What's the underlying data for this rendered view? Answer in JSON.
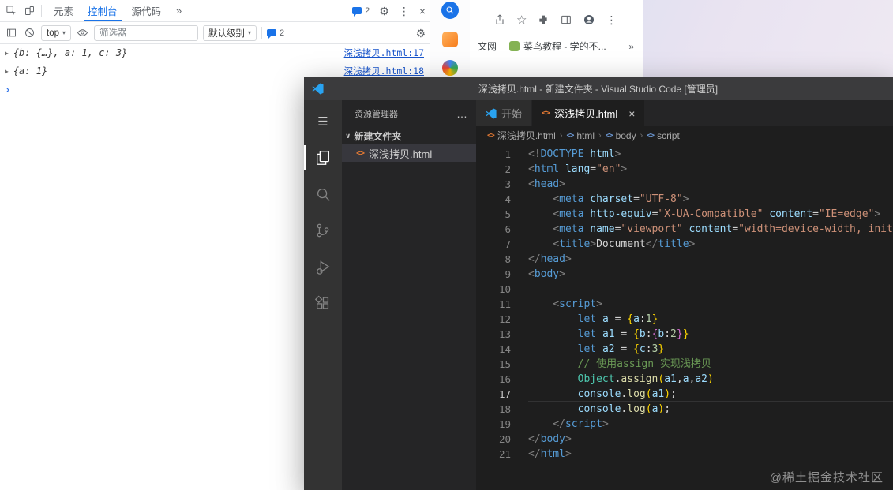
{
  "devtools": {
    "tabs": [
      {
        "label": "元素",
        "active": false
      },
      {
        "label": "控制台",
        "active": true
      },
      {
        "label": "源代码",
        "active": false
      }
    ],
    "tabs_overflow": "»",
    "header_issues_count": "2",
    "toolbar": {
      "context_value": "top",
      "filter_placeholder": "筛选器",
      "levels_value": "默认级别",
      "issues_count": "2"
    },
    "messages": [
      {
        "preview": "{b: {…}, a: 1, c: 3}",
        "source_link": "深浅拷贝.html:17"
      },
      {
        "preview": "{a: 1}",
        "source_link": "深浅拷贝.html:18"
      }
    ],
    "prompt_glyph": "›"
  },
  "browser": {
    "bookmarks": [
      {
        "label": "文网",
        "favicon": false
      },
      {
        "label": "菜鸟教程 - 学的不...",
        "favicon": true
      }
    ],
    "bookmarks_overflow": "»"
  },
  "vscode": {
    "title": "深浅拷贝.html - 新建文件夹 - Visual Studio Code [管理员]",
    "explorer": {
      "header": "资源管理器",
      "actions": "…",
      "folder": "新建文件夹",
      "file": "深浅拷贝.html"
    },
    "tabs": [
      {
        "label": "开始",
        "icon": "vscode",
        "active": false,
        "closable": false
      },
      {
        "label": "深浅拷贝.html",
        "icon": "html",
        "active": true,
        "closable": true
      }
    ],
    "breadcrumbs": [
      "深浅拷贝.html",
      "html",
      "body",
      "script"
    ],
    "code": {
      "active_line": 17,
      "lines": [
        [
          [
            "pun",
            "<!"
          ],
          [
            "tag",
            "DOCTYPE"
          ],
          [
            "txt",
            " "
          ],
          [
            "attr",
            "html"
          ],
          [
            "pun",
            ">"
          ]
        ],
        [
          [
            "pun",
            "<"
          ],
          [
            "tag",
            "html"
          ],
          [
            "txt",
            " "
          ],
          [
            "attr",
            "lang"
          ],
          [
            "txt",
            "="
          ],
          [
            "str",
            "\"en\""
          ],
          [
            "pun",
            ">"
          ]
        ],
        [
          [
            "pun",
            "<"
          ],
          [
            "tag",
            "head"
          ],
          [
            "pun",
            ">"
          ]
        ],
        [
          [
            "txt",
            "    "
          ],
          [
            "pun",
            "<"
          ],
          [
            "tag",
            "meta"
          ],
          [
            "txt",
            " "
          ],
          [
            "attr",
            "charset"
          ],
          [
            "txt",
            "="
          ],
          [
            "str",
            "\"UTF-8\""
          ],
          [
            "pun",
            ">"
          ]
        ],
        [
          [
            "txt",
            "    "
          ],
          [
            "pun",
            "<"
          ],
          [
            "tag",
            "meta"
          ],
          [
            "txt",
            " "
          ],
          [
            "attr",
            "http-equiv"
          ],
          [
            "txt",
            "="
          ],
          [
            "str",
            "\"X-UA-Compatible\""
          ],
          [
            "txt",
            " "
          ],
          [
            "attr",
            "content"
          ],
          [
            "txt",
            "="
          ],
          [
            "str",
            "\"IE=edge\""
          ],
          [
            "pun",
            ">"
          ]
        ],
        [
          [
            "txt",
            "    "
          ],
          [
            "pun",
            "<"
          ],
          [
            "tag",
            "meta"
          ],
          [
            "txt",
            " "
          ],
          [
            "attr",
            "name"
          ],
          [
            "txt",
            "="
          ],
          [
            "str",
            "\"viewport\""
          ],
          [
            "txt",
            " "
          ],
          [
            "attr",
            "content"
          ],
          [
            "txt",
            "="
          ],
          [
            "str",
            "\"width=device-width, initi"
          ]
        ],
        [
          [
            "txt",
            "    "
          ],
          [
            "pun",
            "<"
          ],
          [
            "tag",
            "title"
          ],
          [
            "pun",
            ">"
          ],
          [
            "txt",
            "Document"
          ],
          [
            "pun",
            "</"
          ],
          [
            "tag",
            "title"
          ],
          [
            "pun",
            ">"
          ]
        ],
        [
          [
            "pun",
            "</"
          ],
          [
            "tag",
            "head"
          ],
          [
            "pun",
            ">"
          ]
        ],
        [
          [
            "pun",
            "<"
          ],
          [
            "tag",
            "body"
          ],
          [
            "pun",
            ">"
          ]
        ],
        [],
        [
          [
            "txt",
            "    "
          ],
          [
            "pun",
            "<"
          ],
          [
            "tag",
            "script"
          ],
          [
            "pun",
            ">"
          ]
        ],
        [
          [
            "txt",
            "        "
          ],
          [
            "kw",
            "let"
          ],
          [
            "txt",
            " "
          ],
          [
            "var",
            "a"
          ],
          [
            "txt",
            " = "
          ],
          [
            "b1",
            "{"
          ],
          [
            "var",
            "a"
          ],
          [
            "txt",
            ":"
          ],
          [
            "num",
            "1"
          ],
          [
            "b1",
            "}"
          ]
        ],
        [
          [
            "txt",
            "        "
          ],
          [
            "kw",
            "let"
          ],
          [
            "txt",
            " "
          ],
          [
            "var",
            "a1"
          ],
          [
            "txt",
            " = "
          ],
          [
            "b1",
            "{"
          ],
          [
            "var",
            "b"
          ],
          [
            "txt",
            ":"
          ],
          [
            "b2",
            "{"
          ],
          [
            "var",
            "b"
          ],
          [
            "txt",
            ":"
          ],
          [
            "num",
            "2"
          ],
          [
            "b2",
            "}"
          ],
          [
            "b1",
            "}"
          ]
        ],
        [
          [
            "txt",
            "        "
          ],
          [
            "kw",
            "let"
          ],
          [
            "txt",
            " "
          ],
          [
            "var",
            "a2"
          ],
          [
            "txt",
            " = "
          ],
          [
            "b1",
            "{"
          ],
          [
            "var",
            "c"
          ],
          [
            "txt",
            ":"
          ],
          [
            "num",
            "3"
          ],
          [
            "b1",
            "}"
          ]
        ],
        [
          [
            "txt",
            "        "
          ],
          [
            "com",
            "// 使用assign 实现浅拷贝"
          ]
        ],
        [
          [
            "txt",
            "        "
          ],
          [
            "cls",
            "Object"
          ],
          [
            "txt",
            "."
          ],
          [
            "fn",
            "assign"
          ],
          [
            "b1",
            "("
          ],
          [
            "var",
            "a1"
          ],
          [
            "txt",
            ","
          ],
          [
            "var",
            "a"
          ],
          [
            "txt",
            ","
          ],
          [
            "var",
            "a2"
          ],
          [
            "b1",
            ")"
          ]
        ],
        [
          [
            "txt",
            "        "
          ],
          [
            "var",
            "console"
          ],
          [
            "txt",
            "."
          ],
          [
            "fn",
            "log"
          ],
          [
            "b1",
            "("
          ],
          [
            "var",
            "a1"
          ],
          [
            "b1",
            ")"
          ],
          [
            "txt",
            ";"
          ],
          [
            "cursor",
            ""
          ]
        ],
        [
          [
            "txt",
            "        "
          ],
          [
            "var",
            "console"
          ],
          [
            "txt",
            "."
          ],
          [
            "fn",
            "log"
          ],
          [
            "b1",
            "("
          ],
          [
            "var",
            "a"
          ],
          [
            "b1",
            ")"
          ],
          [
            "txt",
            ";"
          ]
        ],
        [
          [
            "txt",
            "    "
          ],
          [
            "pun",
            "</"
          ],
          [
            "tag",
            "script"
          ],
          [
            "pun",
            ">"
          ]
        ],
        [
          [
            "pun",
            "</"
          ],
          [
            "tag",
            "body"
          ],
          [
            "pun",
            ">"
          ]
        ],
        [
          [
            "pun",
            "</"
          ],
          [
            "tag",
            "html"
          ],
          [
            "pun",
            ">"
          ]
        ]
      ]
    }
  },
  "icons": {
    "gear": "⚙",
    "kebab": "⋮",
    "close": "×",
    "star": "☆",
    "triangle": "▶",
    "chevron_down": "∨",
    "dropdown": "▾",
    "breadcrumb_sep": "›",
    "more": "…",
    "html_file": "<>"
  },
  "watermark": "@稀土掘金技术社区"
}
